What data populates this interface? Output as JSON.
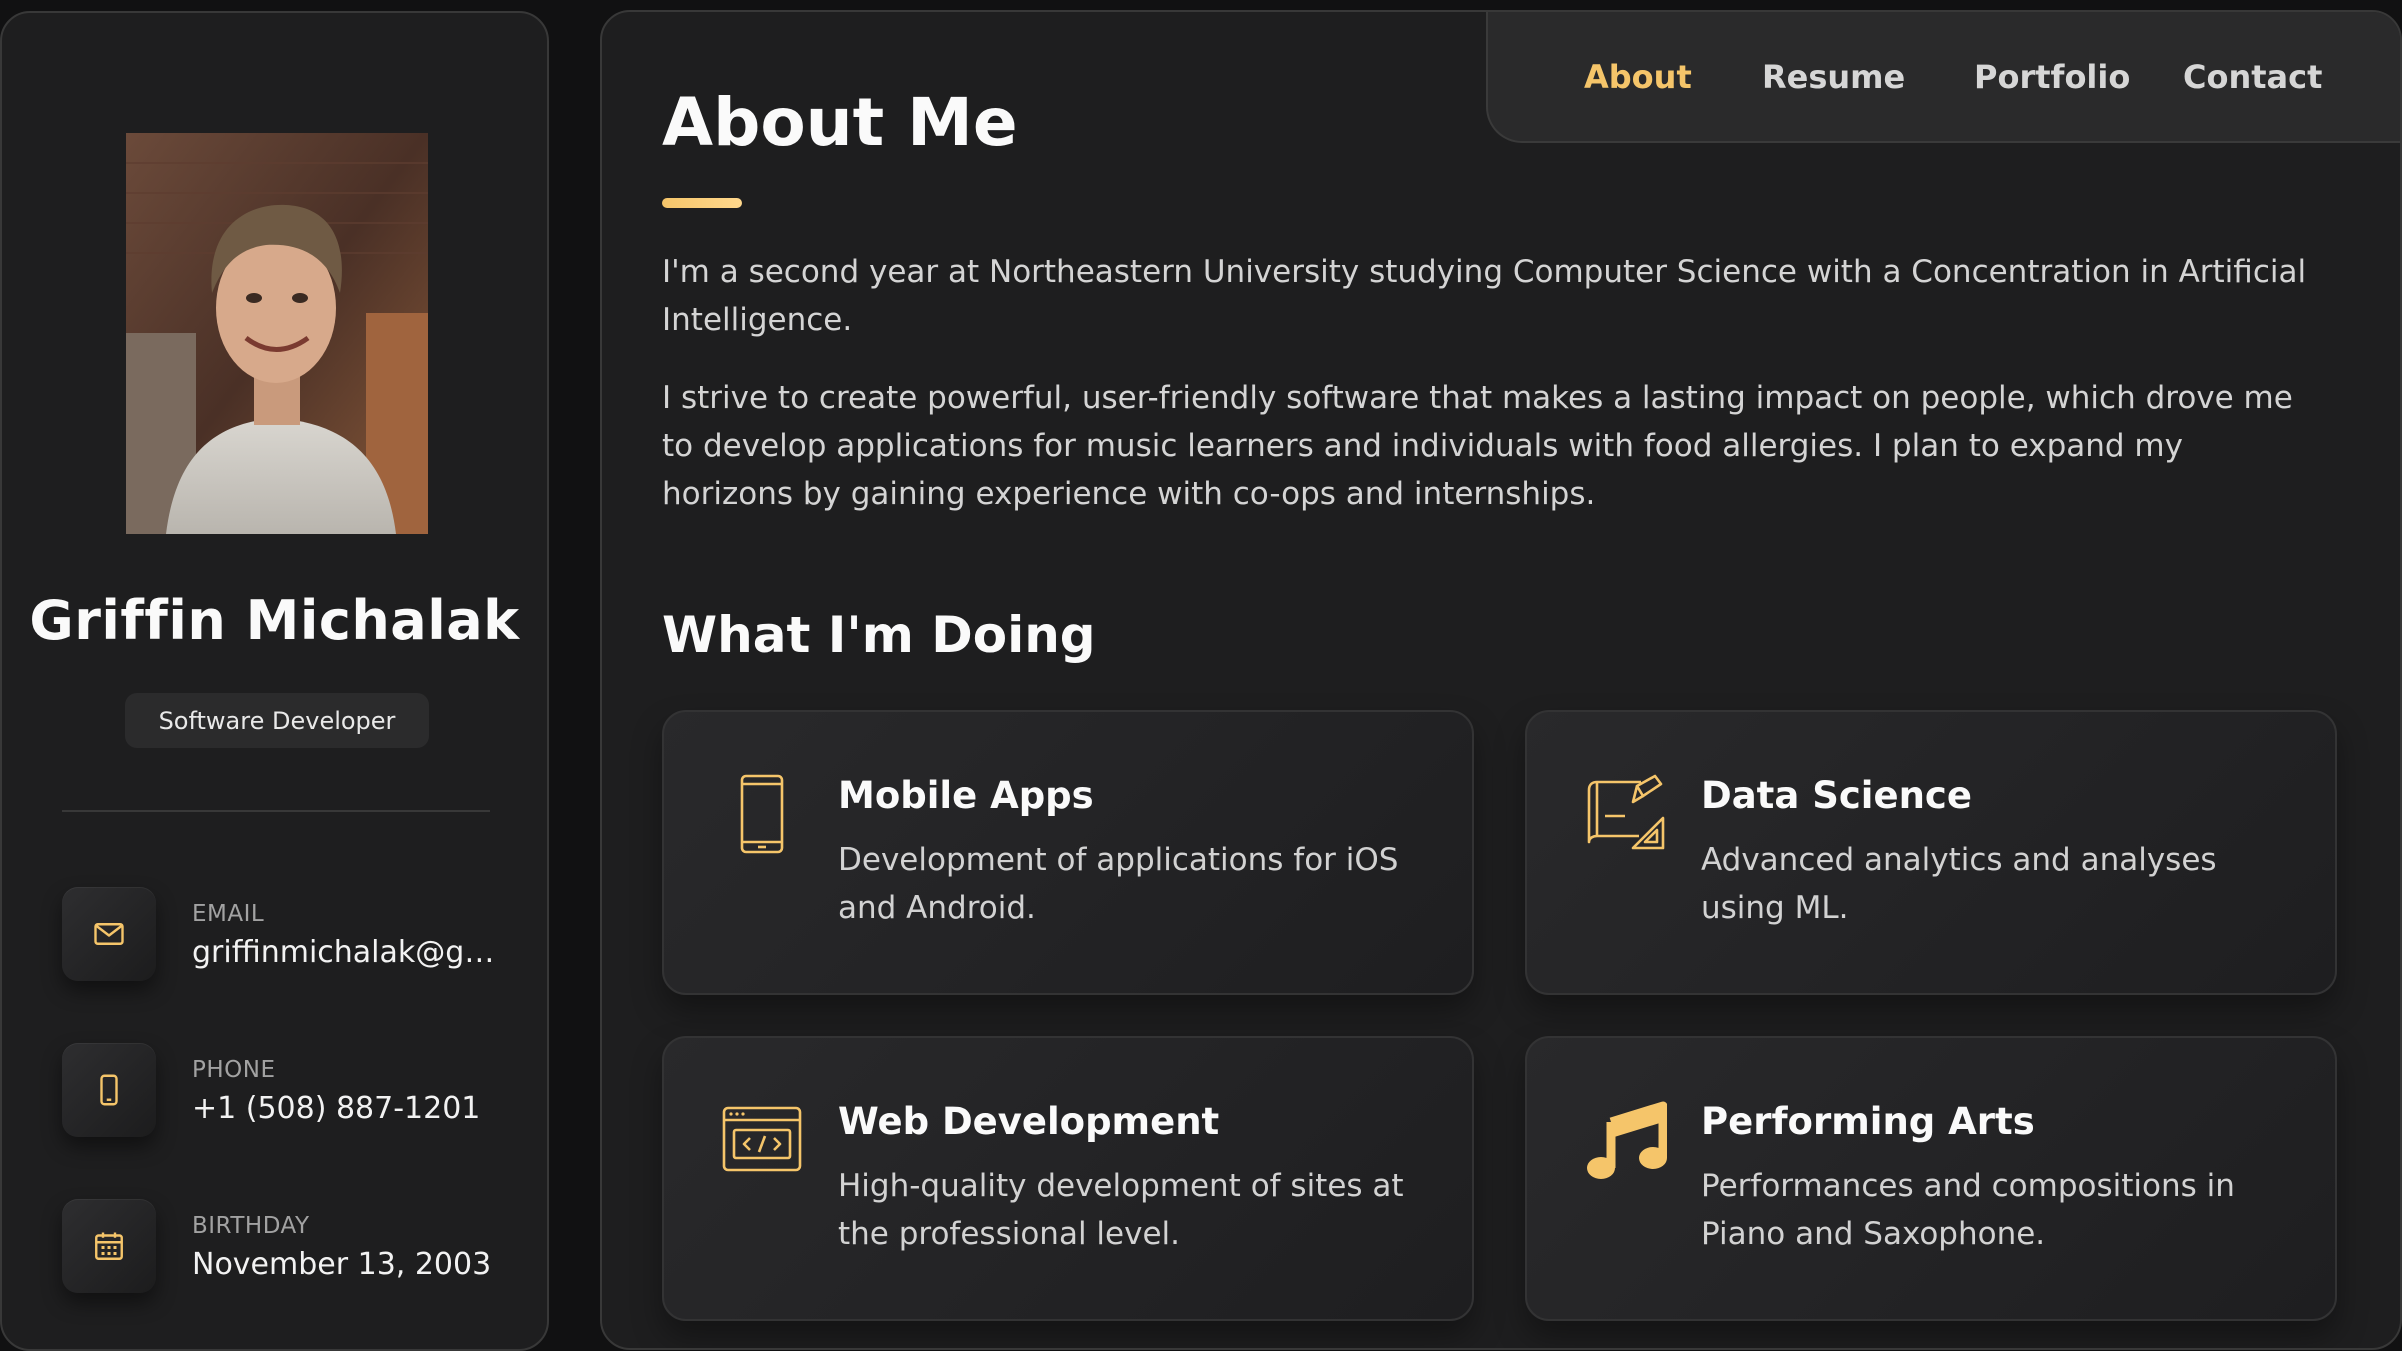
{
  "colors": {
    "accent": "#f5c56a",
    "background": "#111112",
    "panel": "#1e1e1f"
  },
  "sidebar": {
    "name": "Griffin Michalak",
    "title": "Software Developer",
    "contacts": [
      {
        "label": "EMAIL",
        "value": "griffinmichalak@gm...",
        "icon": "mail-icon"
      },
      {
        "label": "PHONE",
        "value": "+1 (508) 887-1201",
        "icon": "phone-icon"
      },
      {
        "label": "BIRTHDAY",
        "value": "November 13, 2003",
        "icon": "calendar-icon"
      }
    ]
  },
  "nav": {
    "items": [
      {
        "label": "About",
        "active": true
      },
      {
        "label": "Resume",
        "active": false
      },
      {
        "label": "Portfolio",
        "active": false
      },
      {
        "label": "Contact",
        "active": false
      }
    ]
  },
  "about": {
    "title": "About Me",
    "paragraphs": [
      "I'm a second year at Northeastern University studying Computer Science with a Concentration in Artificial Intelligence.",
      "I strive to create powerful, user-friendly software that makes a lasting impact on people, which drove me to develop applications for music learners and individuals with food allergies. I plan to expand my horizons by gaining experience with co-ops and internships."
    ]
  },
  "services": {
    "title": "What I'm Doing",
    "items": [
      {
        "title": "Mobile Apps",
        "description": "Development of applications for iOS and Android.",
        "icon": "mobile-icon"
      },
      {
        "title": "Data Science",
        "description": "Advanced analytics and analyses using ML.",
        "icon": "design-tools-icon"
      },
      {
        "title": "Web Development",
        "description": "High-quality development of sites at the professional level.",
        "icon": "code-window-icon"
      },
      {
        "title": "Performing Arts",
        "description": "Performances and compositions in Piano and Saxophone.",
        "icon": "music-note-icon"
      }
    ]
  }
}
